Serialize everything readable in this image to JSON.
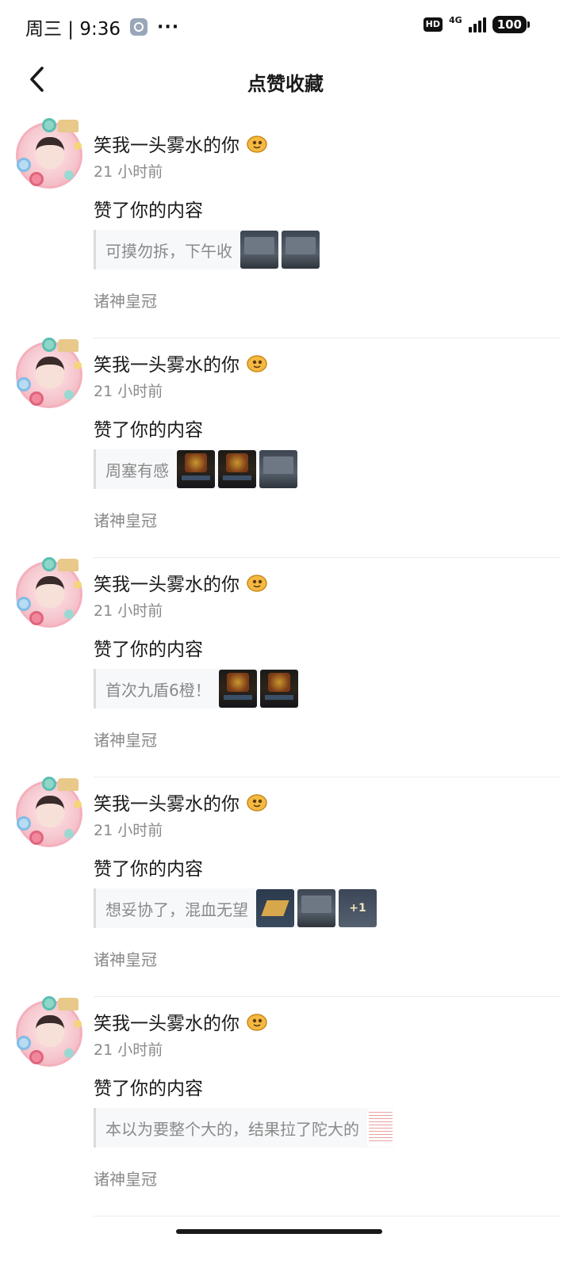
{
  "status_bar": {
    "time": "周三 | 9:36",
    "more": "···",
    "hd": "HD",
    "network": "4G",
    "battery": "100"
  },
  "header": {
    "title": "点赞收藏",
    "back_icon": "chevron-left-icon"
  },
  "notifications": [
    {
      "username": "笑我一头雾水的你",
      "time": "21 小时前",
      "action": "赞了你的内容",
      "quote": "可摸勿拆，下午收",
      "thumbs": [
        "grey",
        "grey"
      ],
      "source": "诸神皇冠"
    },
    {
      "username": "笑我一头雾水的你",
      "time": "21 小时前",
      "action": "赞了你的内容",
      "quote": "周塞有感",
      "thumbs": [
        "dark",
        "dark",
        "grey"
      ],
      "source": "诸神皇冠"
    },
    {
      "username": "笑我一头雾水的你",
      "time": "21 小时前",
      "action": "赞了你的内容",
      "quote": "首次九盾6橙！",
      "thumbs": [
        "dark",
        "dark"
      ],
      "source": "诸神皇冠"
    },
    {
      "username": "笑我一头雾水的你",
      "time": "21 小时前",
      "action": "赞了你的内容",
      "quote": "想妥协了，混血无望",
      "thumbs": [
        "gold",
        "grey",
        "plus"
      ],
      "plus_text": "+1",
      "source": "诸神皇冠"
    },
    {
      "username": "笑我一头雾水的你",
      "time": "21 小时前",
      "action": "赞了你的内容",
      "quote": "本以为要整个大的，结果拉了陀大的",
      "thumbs": [
        "doc"
      ],
      "source": "诸神皇冠"
    }
  ]
}
